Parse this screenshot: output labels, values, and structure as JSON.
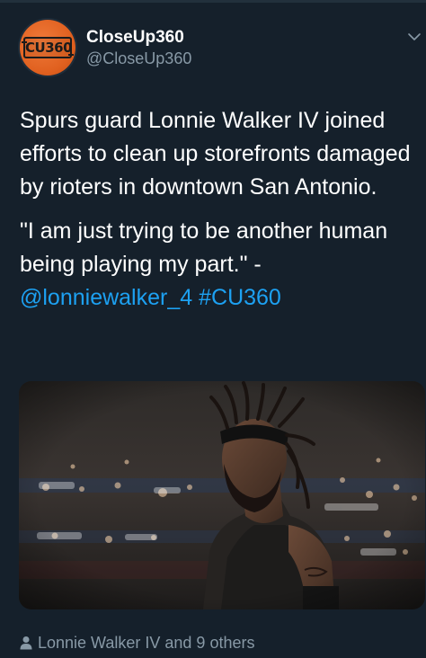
{
  "author": {
    "display_name": "CloseUp360",
    "handle": "@CloseUp360",
    "avatar_text": "CU360",
    "avatar_color": "#e0601f"
  },
  "tweet": {
    "paragraph1": "Spurs guard Lonnie Walker IV joined efforts to clean up storefronts damaged by rioters in downtown San Antonio.",
    "quote": "\"I am just trying to be another human being playing my part.\" -",
    "mention": "@lonniewalker_4",
    "hashtag": "#CU360"
  },
  "media": {
    "icon": "photo-of-basketball-player"
  },
  "footer": {
    "likes_text": "Lonnie Walker IV and 9 others",
    "icon": "person-icon"
  },
  "colors": {
    "background": "#15202b",
    "text": "#ffffff",
    "secondary": "#8899a6",
    "link": "#1da1f2"
  }
}
